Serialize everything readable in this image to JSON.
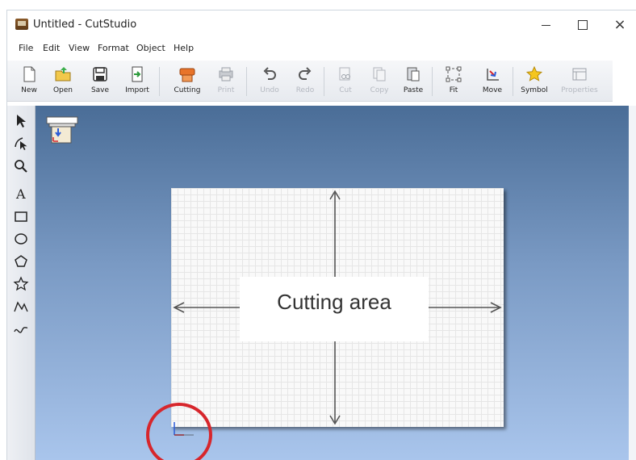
{
  "window": {
    "title": "Untitled - CutStudio"
  },
  "menu": {
    "items": [
      "File",
      "Edit",
      "View",
      "Format",
      "Object",
      "Help"
    ]
  },
  "toolbar": {
    "buttons": [
      {
        "label": "New",
        "icon": "new-document-icon",
        "enabled": true
      },
      {
        "label": "Open",
        "icon": "open-folder-icon",
        "enabled": true
      },
      {
        "label": "Save",
        "icon": "save-disk-icon",
        "enabled": true
      },
      {
        "label": "Import",
        "icon": "import-icon",
        "enabled": true
      },
      {
        "label": "Cutting",
        "icon": "cutting-machine-icon",
        "enabled": true
      },
      {
        "label": "Print",
        "icon": "printer-icon",
        "enabled": false
      },
      {
        "label": "Undo",
        "icon": "undo-icon",
        "enabled": false
      },
      {
        "label": "Redo",
        "icon": "redo-icon",
        "enabled": false
      },
      {
        "label": "Cut",
        "icon": "cut-icon",
        "enabled": false
      },
      {
        "label": "Copy",
        "icon": "copy-icon",
        "enabled": false
      },
      {
        "label": "Paste",
        "icon": "paste-icon",
        "enabled": true
      },
      {
        "label": "Fit",
        "icon": "fit-icon",
        "enabled": true
      },
      {
        "label": "Move",
        "icon": "move-origin-icon",
        "enabled": true
      },
      {
        "label": "Symbol",
        "icon": "star-symbol-icon",
        "enabled": true
      },
      {
        "label": "Properties",
        "icon": "properties-icon",
        "enabled": false
      }
    ]
  },
  "palette": {
    "tools": [
      "select-arrow-icon",
      "edit-points-icon",
      "zoom-icon",
      "text-icon",
      "rectangle-icon",
      "ellipse-icon",
      "polygon-icon",
      "star-icon",
      "polyline-icon",
      "curve-icon"
    ],
    "text_tool_glyph": "A"
  },
  "canvas": {
    "area_label": "Cutting area",
    "highlight_color": "#d7262c"
  }
}
